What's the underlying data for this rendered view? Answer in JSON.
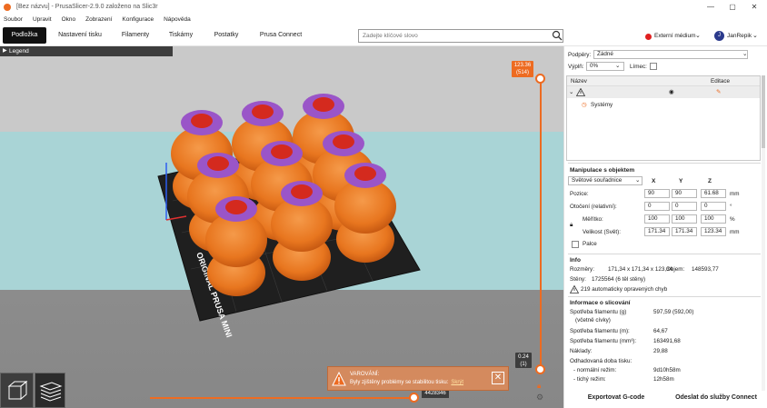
{
  "titlebar": {
    "title": "[Bez názvu] - PrusaSlicer-2.9.0 založeno na Slic3r",
    "minimize": "—",
    "maximize": "▢",
    "close": "✕"
  },
  "menu": [
    "Soubor",
    "Upravit",
    "Okno",
    "Zobrazení",
    "Konfigurace",
    "Nápověda"
  ],
  "tabs": [
    "Podložka",
    "Nastavení tisku",
    "Filamenty",
    "Tiskárny",
    "Postatky",
    "Prusa Connect"
  ],
  "search": {
    "placeholder": "Zadejte klíčové slovo"
  },
  "external": {
    "label": "Externí médium"
  },
  "user": {
    "initial": "J",
    "name": "JanRepik"
  },
  "viewport": {
    "legend": "Legend",
    "bed_text": "ORIGINAL PRUSA MINI",
    "vslider_top": [
      "123.36",
      "(514)"
    ],
    "vslider_bottom": [
      "0.24",
      "(1)"
    ],
    "hslider_value": "4428346"
  },
  "warning": {
    "title": "VAROVÁNÍ:",
    "text": "Byly zjištěny problémy se stabilitou tisku:",
    "link": "Skrýt"
  },
  "panel": {
    "printer_label": "Podpěry:",
    "printer_value": "Žádné",
    "infill_label": "Výplň:",
    "infill_value": "0%",
    "brim_label": "Límec:",
    "list_headers": {
      "name": "Název",
      "editing": "Editace"
    },
    "system_item": "Systémy",
    "manip_title": "Manipulace s objektem",
    "coord_select": "Světové souřadnice",
    "axes": [
      "X",
      "Y",
      "Z"
    ],
    "rows": [
      {
        "label": "Pozice:",
        "values": [
          "90",
          "90",
          "61.68"
        ],
        "unit": "mm"
      },
      {
        "label": "Otočení (relativní):",
        "values": [
          "0",
          "0",
          "0"
        ],
        "unit": "°"
      },
      {
        "label": "Měřítko:",
        "values": [
          "100",
          "100",
          "100"
        ],
        "unit": "%"
      },
      {
        "label": "Velikost (Svět):",
        "values": [
          "171.34",
          "171.34",
          "123.34"
        ],
        "unit": "mm"
      }
    ],
    "inches_label": "Palce",
    "info_title": "Info",
    "info": [
      {
        "label": "Rozměry:",
        "value": "171,34 x 171,34 x 123,34"
      },
      {
        "label": "Objem:",
        "value": "148593,77"
      },
      {
        "label": "Stěny:",
        "value": "1725564 (6 těl stěny)"
      }
    ],
    "repair_text": "219 automaticky opravených chyb",
    "slice_title": "Informace o slicování",
    "slice": [
      {
        "label": "Spotřeba filamentu (g)",
        "value": "597,59 (592,00)"
      },
      {
        "label": "(včetně cívky)",
        "value": ""
      },
      {
        "label": "Spotřeba filamentu (m):",
        "value": "64,67"
      },
      {
        "label": "Spotřeba filamentu (mm³):",
        "value": "163491,68"
      },
      {
        "label": "Náklady:",
        "value": "29,88"
      },
      {
        "label": "Odhadovaná doba tisku:",
        "value": ""
      },
      {
        "label": "- normální režim:",
        "value": "9d10h58m"
      },
      {
        "label": "- tichý režim:",
        "value": "12h58m"
      }
    ],
    "export_btn": "Exportovat G-code",
    "send_btn": "Odeslat do služby Connect"
  },
  "colors": {
    "accent": "#ed6b21",
    "viewport_bg": "#c9c9c9",
    "floor": "#a9d4d6",
    "bed": "#1e1e1e"
  }
}
